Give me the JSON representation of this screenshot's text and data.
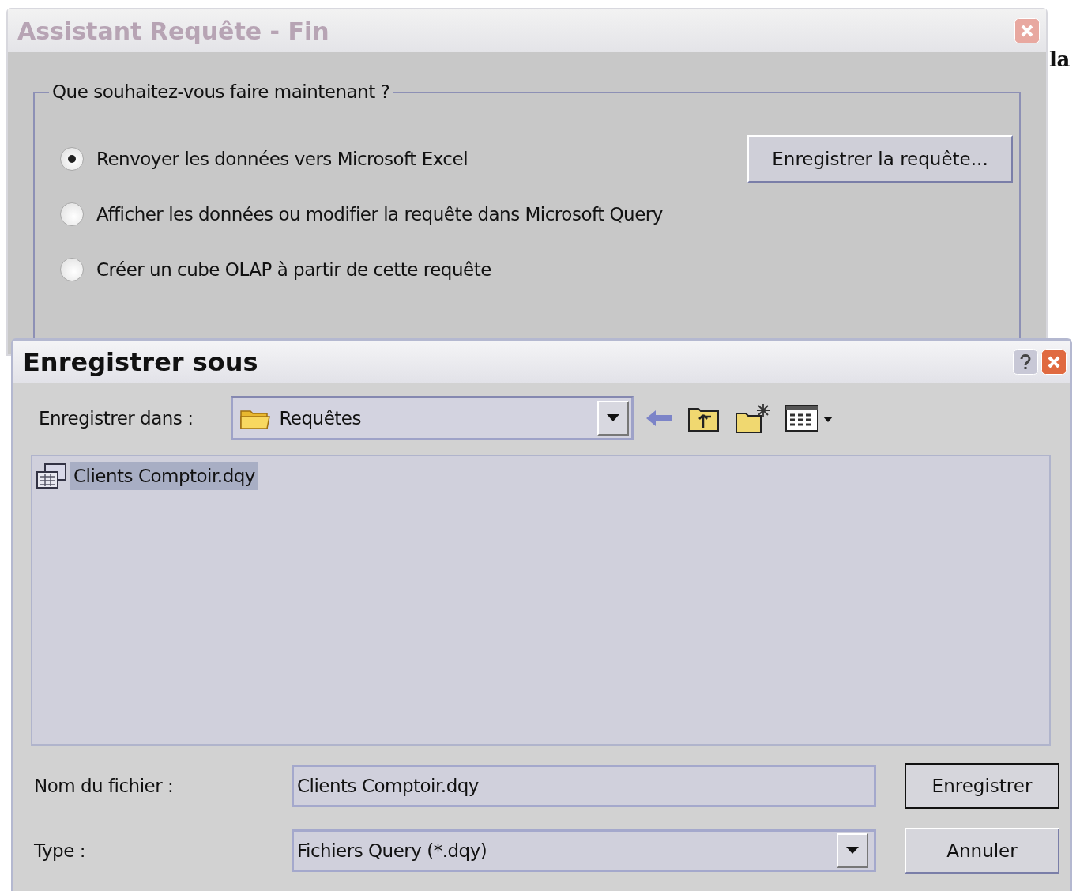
{
  "background_window": {
    "title": "Assistant Requête - Fin",
    "group_label": "Que souhaitez-vous faire maintenant ?",
    "options": [
      {
        "label": "Renvoyer les données vers Microsoft Excel",
        "selected": true
      },
      {
        "label": "Afficher les données ou modifier la requête dans Microsoft Query",
        "selected": false
      },
      {
        "label": "Créer un cube OLAP à partir de cette requête",
        "selected": false
      }
    ],
    "save_query_button": "Enregistrer la requête..."
  },
  "side_text": "la",
  "save_dialog": {
    "title": "Enregistrer sous",
    "save_in_label": "Enregistrer dans :",
    "folder": "Requêtes",
    "files": [
      {
        "name": "Clients Comptoir.dqy",
        "selected": true
      }
    ],
    "file_name_label": "Nom du fichier :",
    "file_name": "Clients Comptoir.dqy",
    "type_label": "Type :",
    "type": "Fichiers Query (*.dqy)",
    "buttons": [
      {
        "label": "Enregistrer",
        "default": true
      },
      {
        "label": "Annuler",
        "default": false
      }
    ]
  }
}
